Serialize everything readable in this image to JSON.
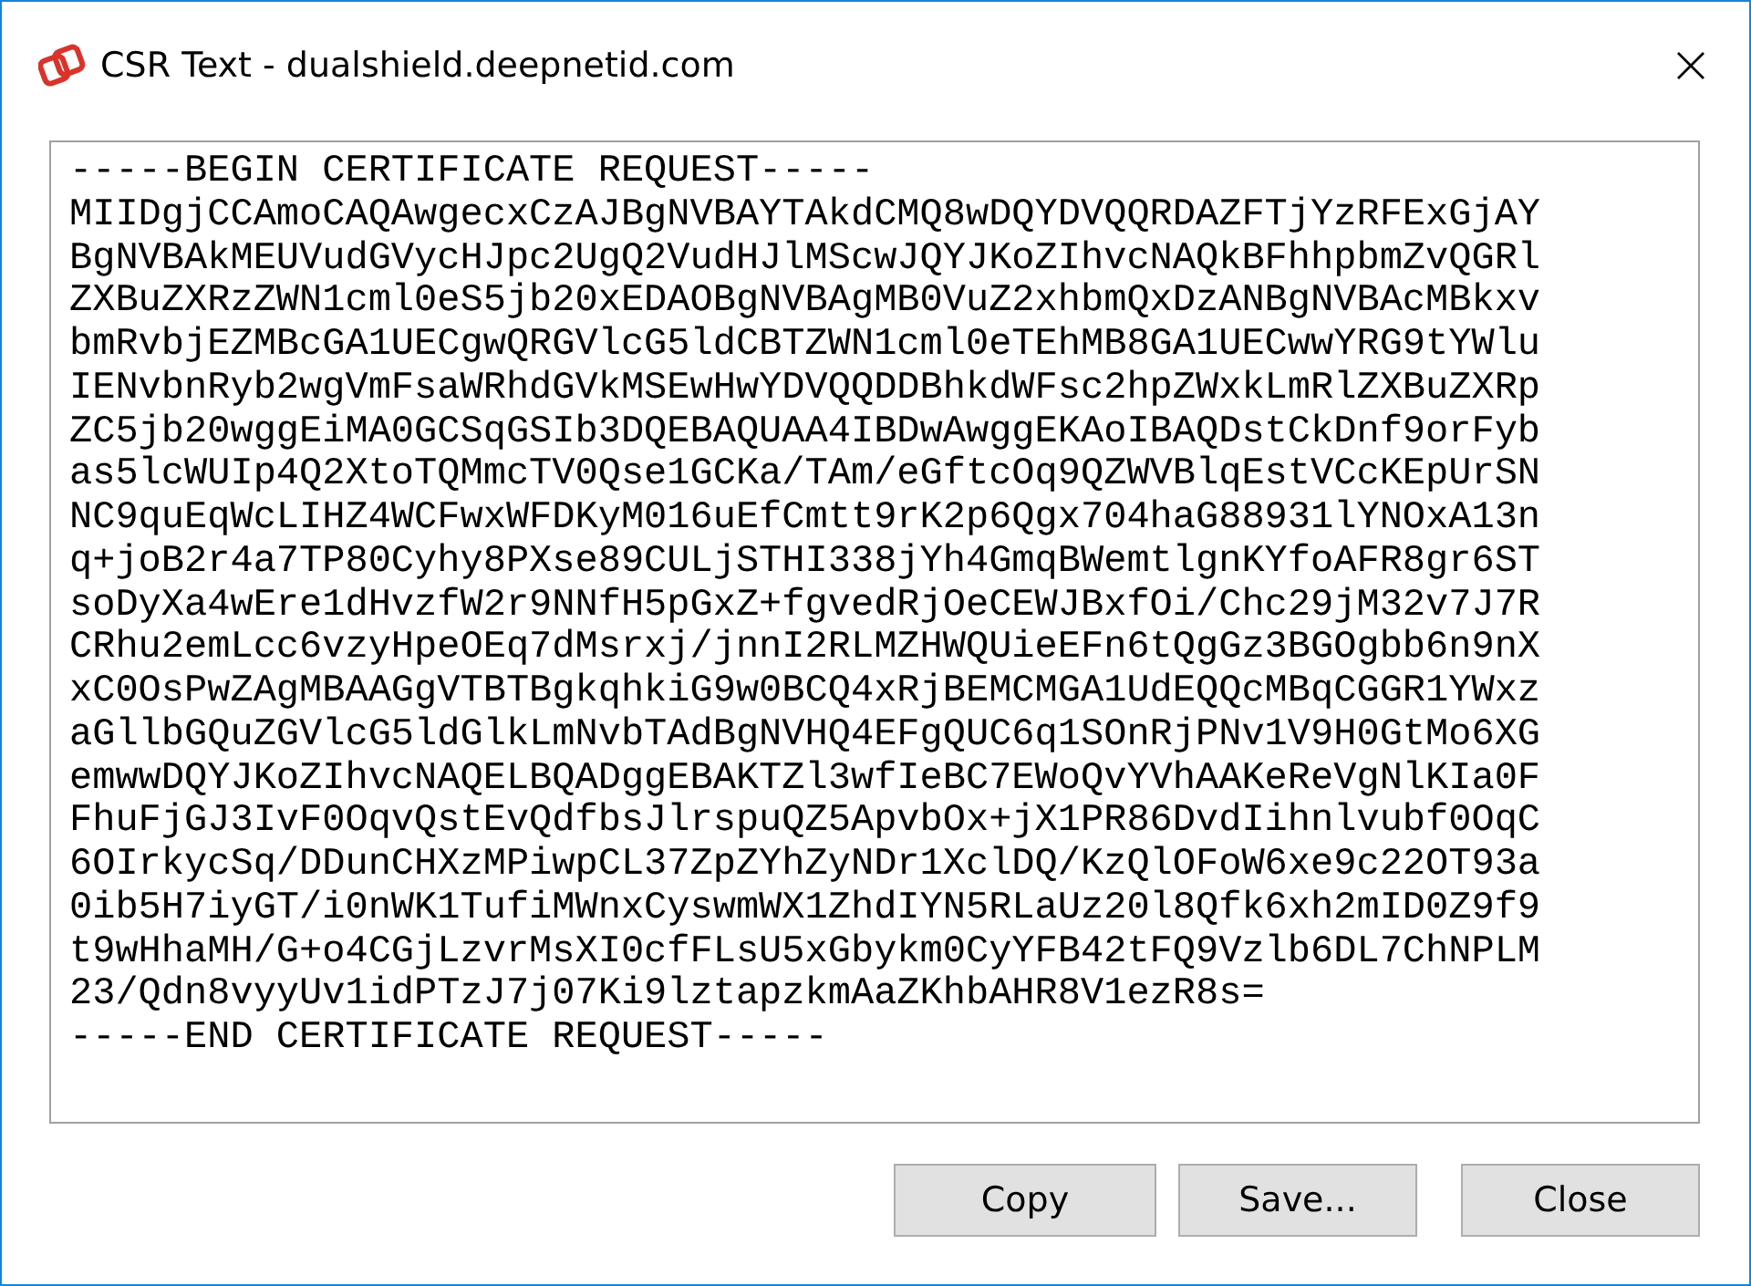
{
  "window": {
    "title": "CSR Text - dualshield.deepnetid.com"
  },
  "csr_text": {
    "lines": [
      "-----BEGIN CERTIFICATE REQUEST-----",
      "MIIDgjCCAmoCAQAwgecxCzAJBgNVBAYTAkdCMQ8wDQYDVQQRDAZFTjYzRFExGjAY",
      "BgNVBAkMEUVudGVycHJpc2UgQ2VudHJlMScwJQYJKoZIhvcNAQkBFhhpbmZvQGRl",
      "ZXBuZXRzZWN1cml0eS5jb20xEDAOBgNVBAgMB0VuZ2xhbmQxDzANBgNVBAcMBkxv",
      "bmRvbjEZMBcGA1UECgwQRGVlcG5ldCBTZWN1cml0eTEhMB8GA1UECwwYRG9tYWlu",
      "IENvbnRyb2wgVmFsaWRhdGVkMSEwHwYDVQQDDBhkdWFsc2hpZWxkLmRlZXBuZXRp",
      "ZC5jb20wggEiMA0GCSqGSIb3DQEBAQUAA4IBDwAwggEKAoIBAQDstCkDnf9orFyb",
      "as5lcWUIp4Q2XtoTQMmcTV0Qse1GCKa/TAm/eGftcOq9QZWVBlqEstVCcKEpUrSN",
      "NC9quEqWcLIHZ4WCFwxWFDKyM016uEfCmtt9rK2p6Qgx704haG88931lYNOxA13n",
      "q+joB2r4a7TP80Cyhy8PXse89CULjSTHI338jYh4GmqBWemtlgnKYfoAFR8gr6ST",
      "soDyXa4wEre1dHvzfW2r9NNfH5pGxZ+fgvedRjOeCEWJBxfOi/Chc29jM32v7J7R",
      "CRhu2emLcc6vzyHpeOEq7dMsrxj/jnnI2RLMZHWQUieEFn6tQgGz3BGOgbb6n9nX",
      "xC0OsPwZAgMBAAGgVTBTBgkqhkiG9w0BCQ4xRjBEMCMGA1UdEQQcMBqCGGR1YWxz",
      "aGllbGQuZGVlcG5ldGlkLmNvbTAdBgNVHQ4EFgQUC6q1SOnRjPNv1V9H0GtMo6XG",
      "emwwDQYJKoZIhvcNAQELBQADggEBAKTZl3wfIeBC7EWoQvYVhAAKeReVgNlKIa0F",
      "FhuFjGJ3IvF0OqvQstEvQdfbsJlrspuQZ5ApvbOx+jX1PR86DvdIihnlvubf0OqC",
      "6OIrkycSq/DDunCHXzMPiwpCL37ZpZYhZyNDr1XclDQ/KzQlOFoW6xe9c22OT93a",
      "0ib5H7iyGT/i0nWK1TufiMWnxCyswmWX1ZhdIYN5RLaUz20l8Qfk6xh2mID0Z9f9",
      "t9wHhaMH/G+o4CGjLzvrMsXI0cfFLsU5xGbykm0CyYFB42tFQ9Vzlb6DL7ChNPLM",
      "23/Qdn8vyyUv1idPTzJ7j07Ki9lztapzkmAaZKhbAHR8V1ezR8s=",
      "-----END CERTIFICATE REQUEST-----"
    ]
  },
  "buttons": [
    "Copy",
    "Save...",
    "Close"
  ]
}
